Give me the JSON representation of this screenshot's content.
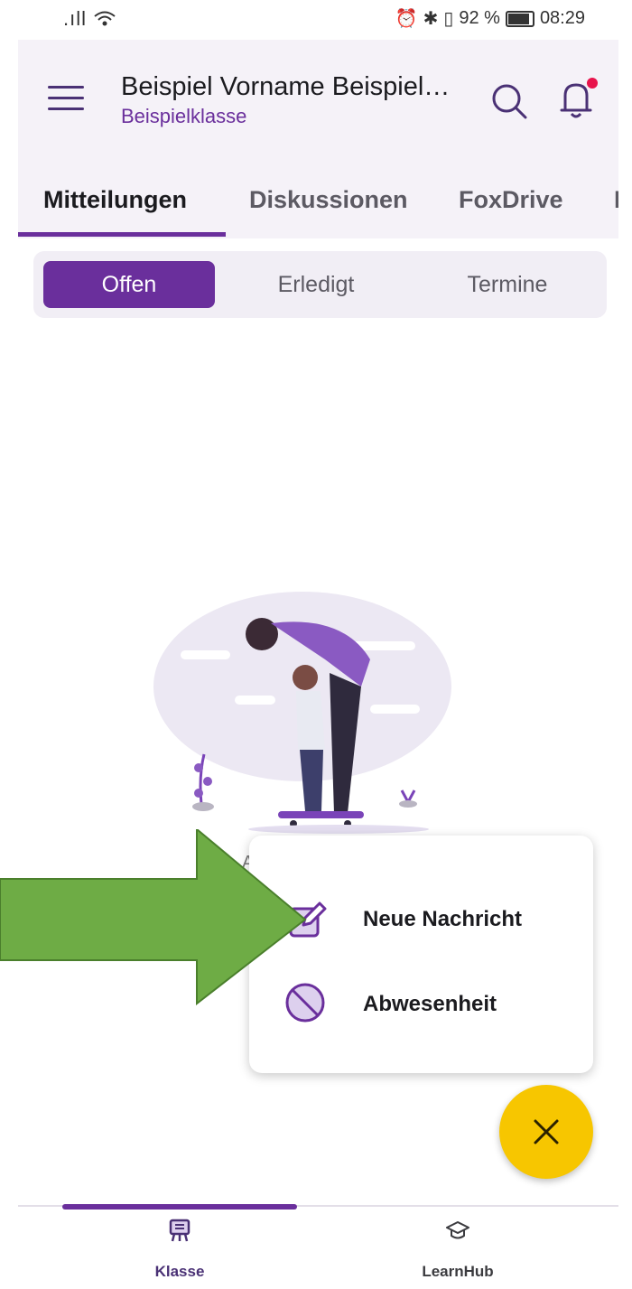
{
  "status_bar": {
    "signal": ".ıll",
    "battery_percent": "92 %",
    "time": "08:29"
  },
  "header": {
    "title": "Beispiel Vorname Beispiel…",
    "subtitle": "Beispielklasse",
    "icons": [
      "menu-icon",
      "search-icon",
      "bell-icon"
    ],
    "notification_dot_color": "#e8144c"
  },
  "tabs": {
    "items": [
      "Mitteilungen",
      "Diskussionen",
      "FoxDrive",
      "F"
    ],
    "active_index": 0
  },
  "segments": {
    "items": [
      "Offen",
      "Erledigt",
      "Termine"
    ],
    "active_index": 0
  },
  "empty_state": {
    "hint_fragment": "A"
  },
  "popup_menu": {
    "items": [
      {
        "label": "Neue Nachricht",
        "icon": "edit-icon"
      },
      {
        "label": "Abwesenheit",
        "icon": "block-icon"
      }
    ]
  },
  "fab": {
    "icon": "close-icon",
    "color": "#f7c600"
  },
  "bottom_nav": {
    "items": [
      {
        "label": "Klasse",
        "icon": "classroom-icon"
      },
      {
        "label": "LearnHub",
        "icon": "graduation-cap-icon"
      }
    ],
    "active_index": 0
  },
  "colors": {
    "accent": "#6a2f9c",
    "header_bg": "#f5f2f8",
    "annotation_arrow": "#6eac45"
  }
}
